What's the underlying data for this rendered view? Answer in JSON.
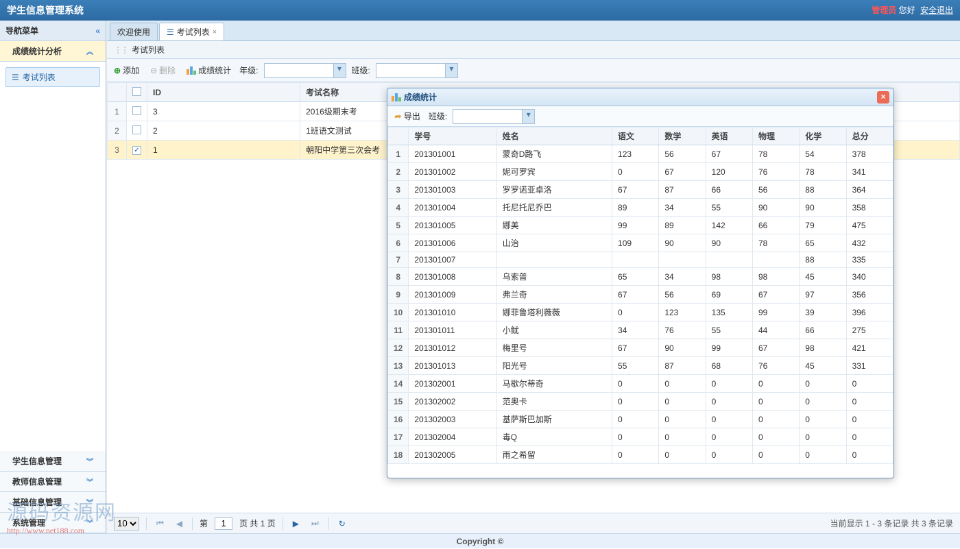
{
  "header": {
    "title": "学生信息管理系统",
    "user": "管理员",
    "greet": "您好",
    "logout": "安全退出"
  },
  "sidebar": {
    "title": "导航菜单",
    "active": "成绩统计分析",
    "tree_item": "考试列表",
    "sections": [
      "学生信息管理",
      "教师信息管理",
      "基础信息管理",
      "系统管理"
    ]
  },
  "tabs": {
    "welcome": "欢迎使用",
    "examlist": "考试列表"
  },
  "panel": {
    "title": "考试列表"
  },
  "toolbar": {
    "add": "添加",
    "del": "删除",
    "stat": "成绩统计",
    "grade_label": "年级:",
    "class_label": "班级:"
  },
  "grid": {
    "cols": {
      "id": "ID",
      "name": "考试名称"
    },
    "rows": [
      {
        "idx": "1",
        "id": "3",
        "name": "2016级期末考",
        "checked": false
      },
      {
        "idx": "2",
        "id": "2",
        "name": "1班语文测试",
        "checked": false
      },
      {
        "idx": "3",
        "id": "1",
        "name": "朝阳中学第三次会考",
        "checked": true
      }
    ]
  },
  "pager": {
    "size": "10",
    "page": "1",
    "prefix": "第",
    "mid": "页 共 1 页",
    "info": "当前显示 1 - 3 条记录 共 3 条记录"
  },
  "footer": "Copyright ©",
  "dialog": {
    "title": "成绩统计",
    "export": "导出",
    "class_label": "班级:",
    "cols": [
      "学号",
      "姓名",
      "语文",
      "数学",
      "英语",
      "物理",
      "化学",
      "总分"
    ],
    "rows": [
      [
        "1",
        "201301001",
        "蒙奇D路飞",
        "123",
        "56",
        "67",
        "78",
        "54",
        "378"
      ],
      [
        "2",
        "201301002",
        "妮可罗宾",
        "0",
        "67",
        "120",
        "76",
        "78",
        "341"
      ],
      [
        "3",
        "201301003",
        "罗罗诺亚卓洛",
        "67",
        "87",
        "66",
        "56",
        "88",
        "364"
      ],
      [
        "4",
        "201301004",
        "托尼托尼乔巴",
        "89",
        "34",
        "55",
        "90",
        "90",
        "358"
      ],
      [
        "5",
        "201301005",
        "娜美",
        "99",
        "89",
        "142",
        "66",
        "79",
        "475"
      ],
      [
        "6",
        "201301006",
        "山治",
        "109",
        "90",
        "90",
        "78",
        "65",
        "432"
      ],
      [
        "7",
        "201301007",
        "",
        "",
        "",
        "",
        "",
        "88",
        "335"
      ],
      [
        "8",
        "201301008",
        "乌索普",
        "65",
        "34",
        "98",
        "98",
        "45",
        "340"
      ],
      [
        "9",
        "201301009",
        "弗兰奇",
        "67",
        "56",
        "69",
        "67",
        "97",
        "356"
      ],
      [
        "10",
        "201301010",
        "娜菲鲁塔利薇薇",
        "0",
        "123",
        "135",
        "99",
        "39",
        "396"
      ],
      [
        "11",
        "201301011",
        "小鱿",
        "34",
        "76",
        "55",
        "44",
        "66",
        "275"
      ],
      [
        "12",
        "201301012",
        "梅里号",
        "67",
        "90",
        "99",
        "67",
        "98",
        "421"
      ],
      [
        "13",
        "201301013",
        "阳光号",
        "55",
        "87",
        "68",
        "76",
        "45",
        "331"
      ],
      [
        "14",
        "201302001",
        "马歇尔蒂奇",
        "0",
        "0",
        "0",
        "0",
        "0",
        "0"
      ],
      [
        "15",
        "201302002",
        "范奥卡",
        "0",
        "0",
        "0",
        "0",
        "0",
        "0"
      ],
      [
        "16",
        "201302003",
        "基萨斯巴加斯",
        "0",
        "0",
        "0",
        "0",
        "0",
        "0"
      ],
      [
        "17",
        "201302004",
        "毒Q",
        "0",
        "0",
        "0",
        "0",
        "0",
        "0"
      ],
      [
        "18",
        "201302005",
        "雨之希留",
        "0",
        "0",
        "0",
        "0",
        "0",
        "0"
      ]
    ]
  },
  "watermark": {
    "text": "源码资源网",
    "url": "http://www.net188.com"
  }
}
